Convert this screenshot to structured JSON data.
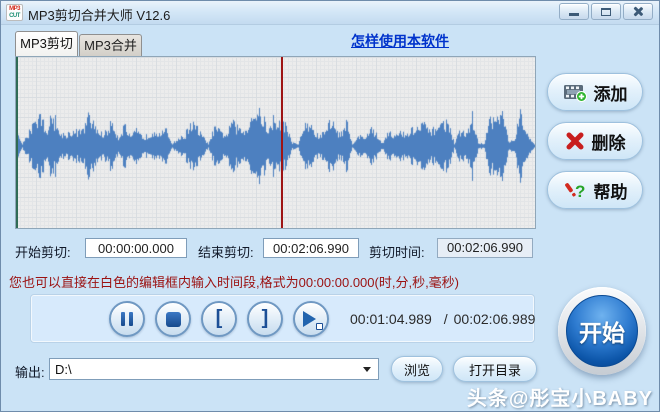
{
  "window": {
    "title": "MP3剪切合并大师 V12.6",
    "icon": {
      "top": "MP3",
      "bottom": "CUT"
    }
  },
  "tabs": [
    {
      "label": "MP3剪切"
    },
    {
      "label": "MP3合并"
    }
  ],
  "help_link": {
    "label": "怎样使用本软件"
  },
  "side_buttons": {
    "add": "添加",
    "delete": "删除",
    "help": "帮助",
    "help_icon_glyph": "?"
  },
  "cut": {
    "start_label": "开始剪切:",
    "start_value": "00:00:00.000",
    "end_label": "结束剪切:",
    "end_value": "00:02:06.990",
    "duration_label": "剪切时间:",
    "duration_value": "00:02:06.990"
  },
  "hint": "您也可以直接在白色的编辑框内输入时间段,格式为00:00:00.000(时,分,秒,毫秒)",
  "player": {
    "mark_start_glyph": "[",
    "mark_end_glyph": "]",
    "current_time": "00:01:04.989",
    "separator": "/",
    "total_time": "00:02:06.989"
  },
  "start_button_label": "开始",
  "output": {
    "label": "输出:",
    "path": "D:\\",
    "browse_label": "浏览",
    "open_dir_label": "打开目录"
  },
  "watermark": "头条@彤宝小BABY",
  "colors": {
    "waveform": "#4d80c0",
    "cursor": "#9e1414",
    "start_marker": "#2f6b55",
    "accent_blue": "#1261b8",
    "link": "#0033cc",
    "hint_text": "#9b1111"
  }
}
